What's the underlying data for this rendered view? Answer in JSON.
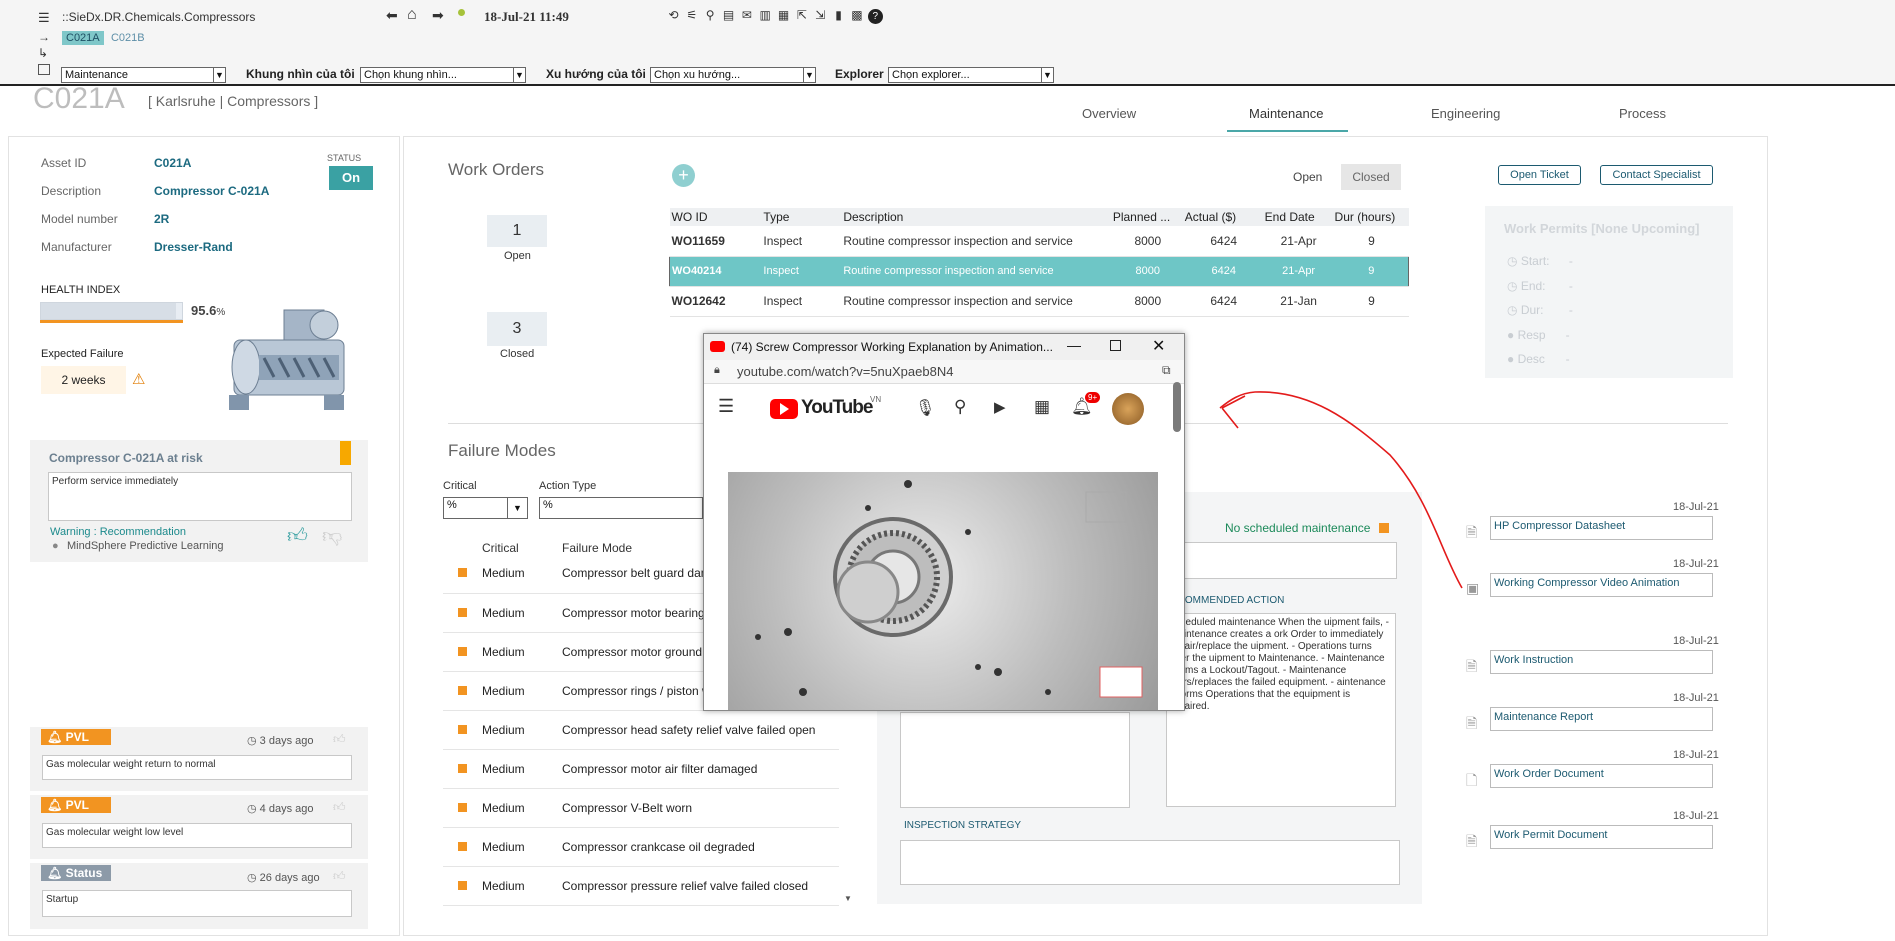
{
  "topbar": {
    "breadcrumb": "::SieDx.DR.Chemicals.Compressors",
    "tags": [
      "C021A",
      "C021B"
    ],
    "datetime": "18-Jul-21 11:49",
    "view_select": "Maintenance",
    "my_view_label": "Khung nhìn của tôi",
    "my_view_value": "Chọn khung nhìn...",
    "my_trend_label": "Xu hướng của tôi",
    "my_trend_value": "Chọn xu hướng...",
    "explorer_label": "Explorer",
    "explorer_value": "Chọn explorer..."
  },
  "asset": {
    "title": "C021A",
    "subtitle": "[ Karlsruhe | Compressors ]",
    "tabs": [
      "Overview",
      "Maintenance",
      "Engineering",
      "Process"
    ],
    "active_tab": "Maintenance"
  },
  "info": {
    "rows": [
      {
        "label": "Asset ID",
        "value": "C021A"
      },
      {
        "label": "Description",
        "value": "Compressor C-021A"
      },
      {
        "label": "Model number",
        "value": "2R"
      },
      {
        "label": "Manufacturer",
        "value": "Dresser-Rand"
      }
    ],
    "status_label": "STATUS",
    "status_value": "On",
    "health_label": "HEALTH INDEX",
    "health_value": "95.6",
    "health_unit": "%",
    "health_fraction": 0.956,
    "expected_failure_label": "Expected Failure",
    "expected_failure_value": "2 weeks"
  },
  "risk": {
    "title": "Compressor C-021A at risk",
    "text": "Perform service immediately",
    "warning": "Warning : Recommendation",
    "source": "MindSphere Predictive Learning"
  },
  "alerts": [
    {
      "chip": "PVL",
      "time": "3 days ago",
      "text": "Gas molecular weight return to normal"
    },
    {
      "chip": "PVL",
      "time": "4 days ago",
      "text": "Gas molecular weight low level"
    },
    {
      "chip": "Status",
      "time": "26 days ago",
      "text": "Startup"
    }
  ],
  "work_orders": {
    "title": "Work Orders",
    "open_count": "1",
    "open_label": "Open",
    "closed_count": "3",
    "closed_label": "Closed",
    "toggle_open": "Open",
    "toggle_closed": "Closed",
    "columns": [
      "WO ID",
      "Type",
      "Description",
      "Planned ...",
      "Actual ($)",
      "End Date",
      "Dur (hours)"
    ],
    "rows": [
      [
        "WO11659",
        "Inspect",
        "Routine compressor inspection and service",
        "8000",
        "6424",
        "21-Apr",
        "9"
      ],
      [
        "WO40214",
        "Inspect",
        "Routine compressor inspection and service",
        "8000",
        "6424",
        "21-Apr",
        "9"
      ],
      [
        "WO12642",
        "Inspect",
        "Routine compressor inspection and service",
        "8000",
        "6424",
        "21-Jan",
        "9"
      ]
    ]
  },
  "actions": {
    "open_ticket": "Open Ticket",
    "contact_specialist": "Contact Specialist"
  },
  "permits": {
    "title": "Work Permits [None Upcoming]",
    "fields": [
      {
        "label": "Start:",
        "value": "-"
      },
      {
        "label": "End:",
        "value": "-"
      },
      {
        "label": "Dur:",
        "value": "-"
      },
      {
        "label": "Resp",
        "value": "-"
      },
      {
        "label": "Desc",
        "value": "-"
      }
    ]
  },
  "failure_modes": {
    "title": "Failure Modes",
    "filter_critical_label": "Critical",
    "filter_critical_value": "%",
    "filter_action_label": "Action Type",
    "filter_action_value": "%",
    "col_critical": "Critical",
    "col_mode": "Failure Mode",
    "rows": [
      [
        "Medium",
        "Compressor belt guard dam"
      ],
      [
        "Medium",
        "Compressor motor bearing l"
      ],
      [
        "Medium",
        "Compressor motor ground v"
      ],
      [
        "Medium",
        "Compressor rings / piston w"
      ],
      [
        "Medium",
        "Compressor head safety relief valve failed open"
      ],
      [
        "Medium",
        "Compressor motor air filter damaged"
      ],
      [
        "Medium",
        "Compressor V-Belt worn"
      ],
      [
        "Medium",
        "Compressor crankcase oil degraded"
      ],
      [
        "Medium",
        "Compressor pressure relief valve failed closed"
      ]
    ]
  },
  "maintenance_detail": {
    "no_scheduled": "No scheduled maintenance",
    "recommended_label": "ECOMMENDED ACTION",
    "recommended_text": "scheduled maintenance When the uipment fails, - Maintenance creates a ork Order to immediately repair/replace the uipment.  - Operations turns over the uipment to Maintenance.  - Maintenance rforms a Lockout/Tagout.  - Maintenance pairs/replaces the failed equipment. - aintenance informs Operations that the equipment is repaired.",
    "inspection_label": "INSPECTION STRATEGY"
  },
  "documents": [
    {
      "date": "18-Jul-21",
      "name": "HP Compressor Datasheet",
      "icon": "pdf-icon"
    },
    {
      "date": "18-Jul-21",
      "name": "Working Compressor Video Animation",
      "icon": "video-icon"
    },
    {
      "date": "18-Jul-21",
      "name": "Work Instruction",
      "icon": "pdf-icon"
    },
    {
      "date": "18-Jul-21",
      "name": "Maintenance Report",
      "icon": "pdf-icon"
    },
    {
      "date": "18-Jul-21",
      "name": "Work Order Document",
      "icon": "doc-icon"
    },
    {
      "date": "18-Jul-21",
      "name": "Work Permit Document",
      "icon": "pdf-icon"
    }
  ],
  "popup": {
    "title": "(74) Screw Compressor Working Explanation by Animation...",
    "url": "youtube.com/watch?v=5nuXpaeb8N4",
    "brand": "YouTube",
    "region": "VN",
    "notif_count": "9+"
  },
  "colors": {
    "accent_teal": "#6ec6c6",
    "link_blue": "#1c6a80",
    "warning_orange": "#f29421",
    "status_green": "#3aa1a3",
    "annotation_red": "#e31b1b"
  }
}
